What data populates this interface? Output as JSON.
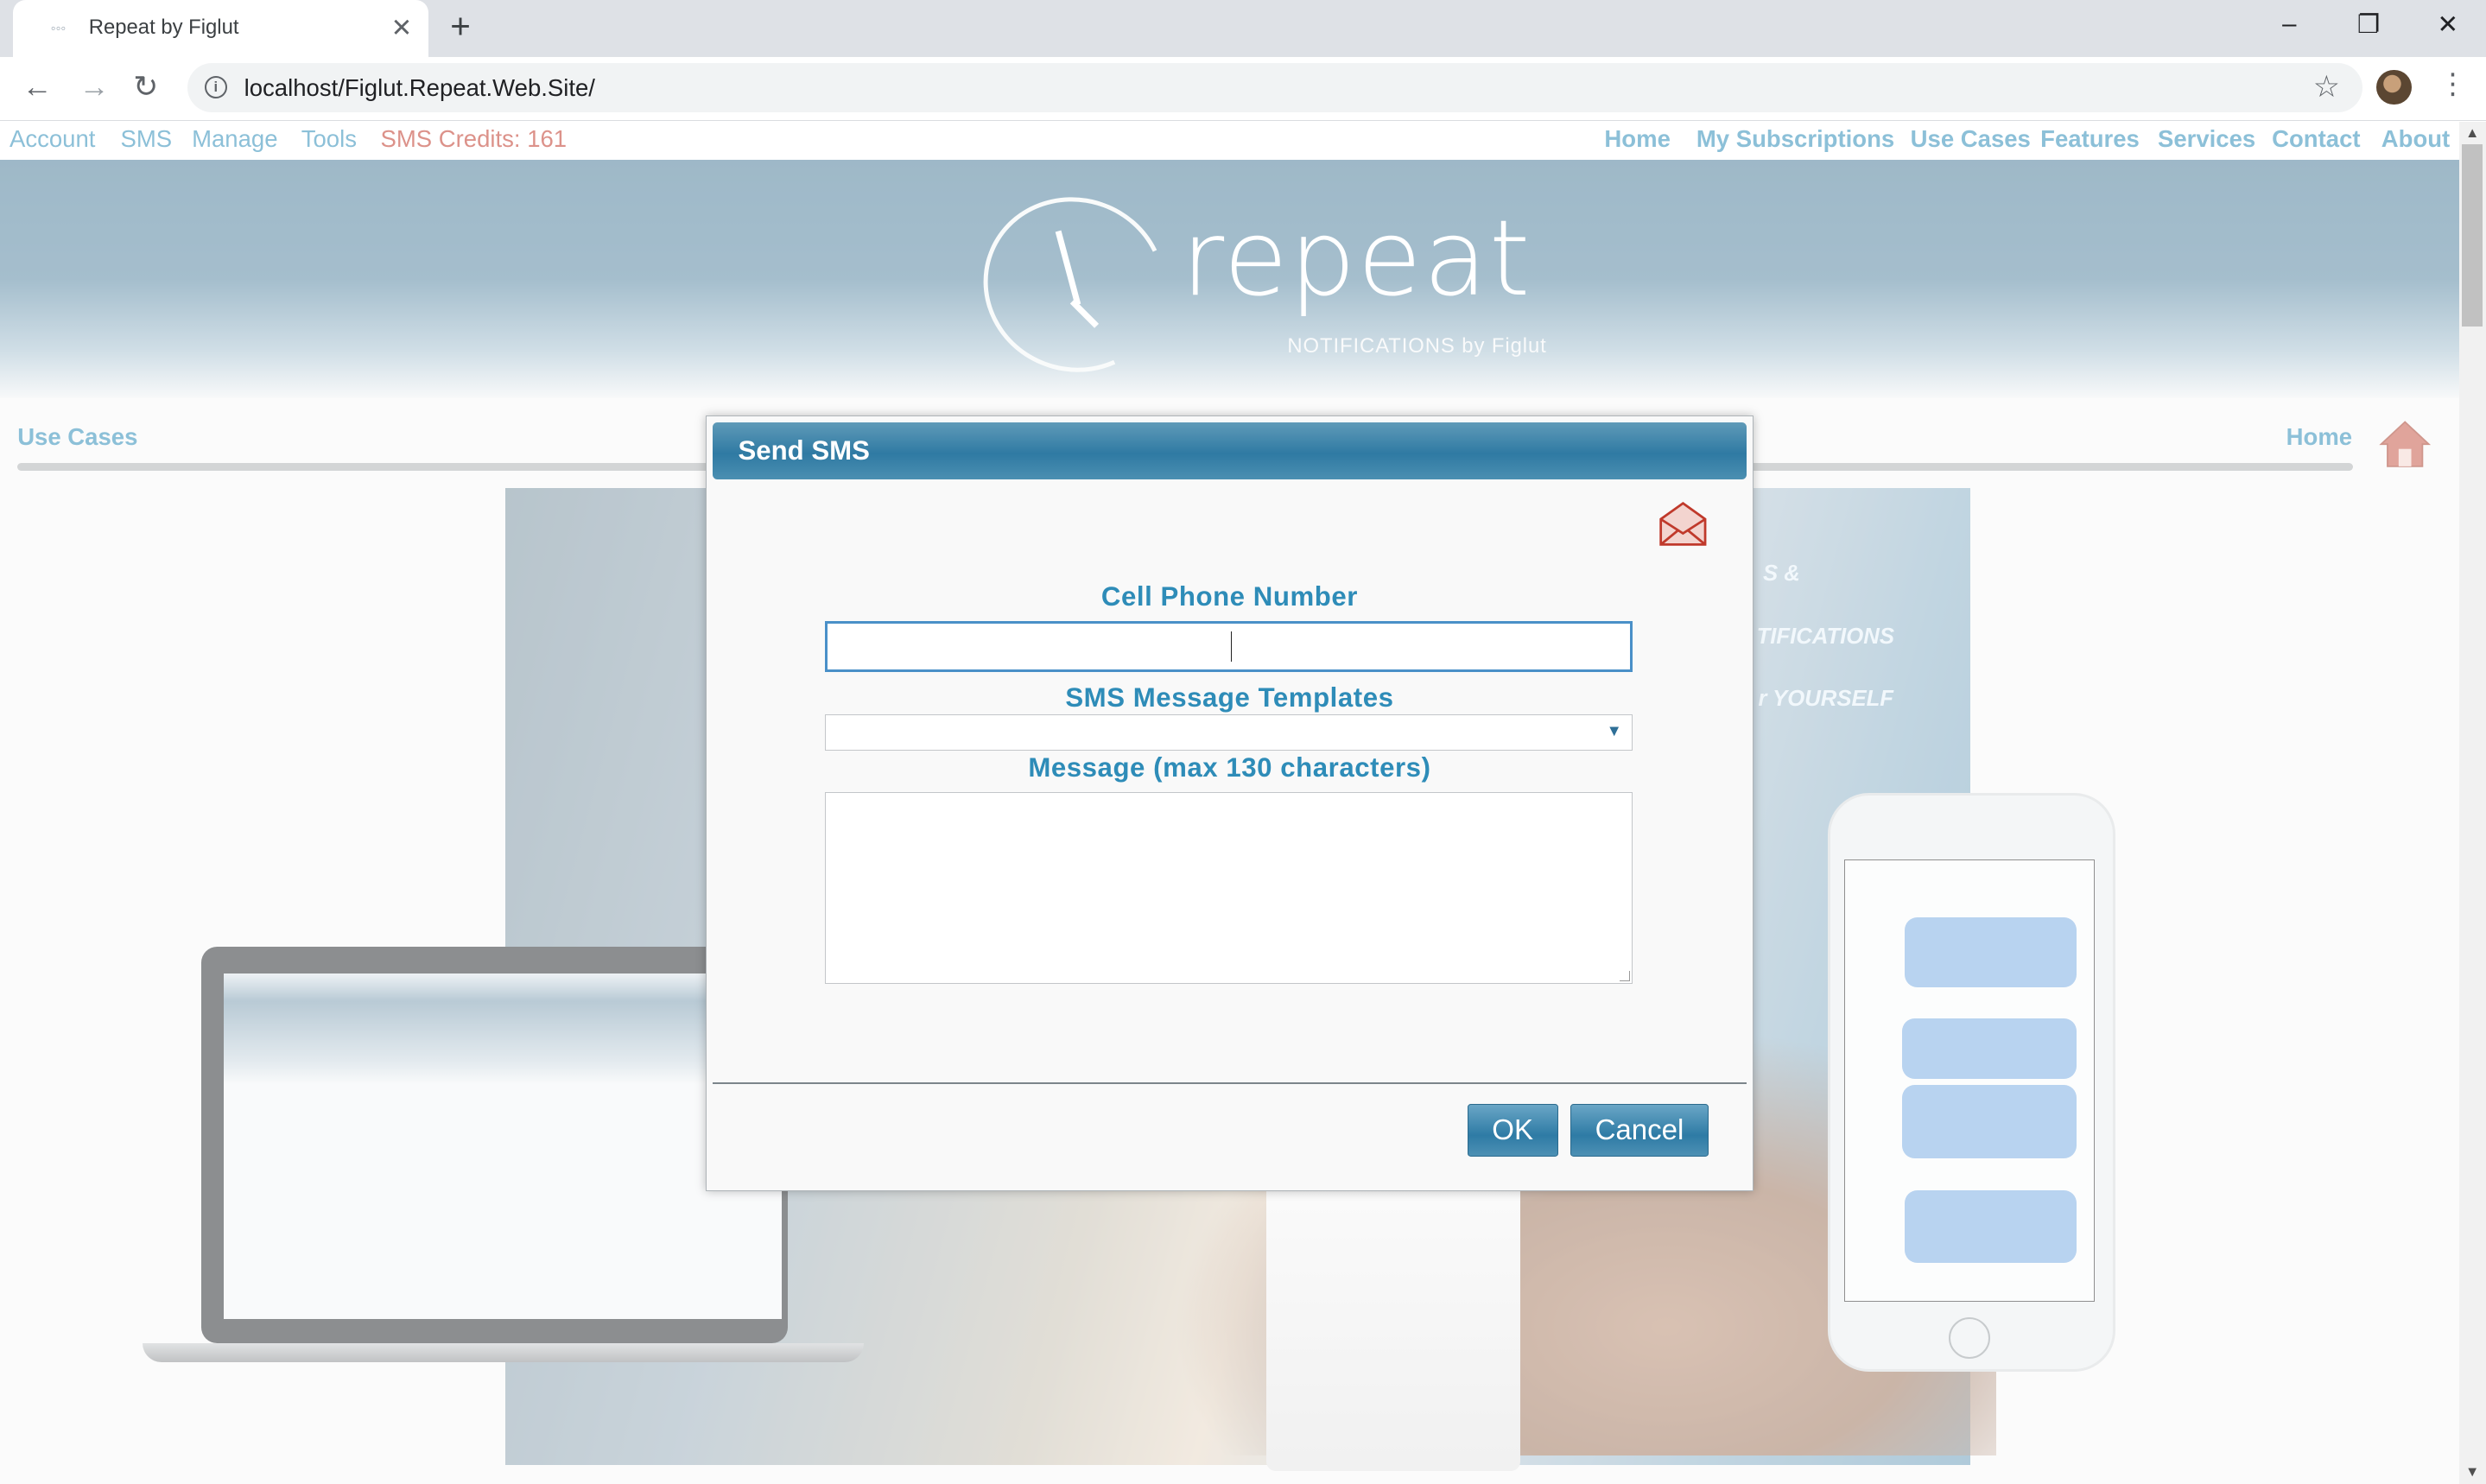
{
  "browser": {
    "tab_title": "Repeat by Figlut",
    "new_tab": "+",
    "close_tab": "✕",
    "url": "localhost/Figlut.Repeat.Web.Site/"
  },
  "site_nav": {
    "left": [
      "Account",
      "SMS",
      "Manage",
      "Tools"
    ],
    "credits": "SMS Credits: 161",
    "right": [
      "Home",
      "My Subscriptions",
      "Use Cases",
      "Features",
      "Services",
      "Contact",
      "About"
    ]
  },
  "banner": {
    "logo_word": "repeat",
    "tagline": "NOTIFICATIONS by Figlut"
  },
  "breadcrumb": {
    "left": "Use Cases",
    "right": "Home"
  },
  "hero": {
    "text_lines": [
      "S &",
      "TIFICATIONS",
      "r YOURSELF"
    ]
  },
  "dialog": {
    "title": "Send SMS",
    "phone_label": "Cell Phone Number",
    "phone_value": "",
    "templates_label": "SMS Message Templates",
    "templates_selected": "",
    "message_label": "Message (max 130 characters)",
    "message_value": "",
    "ok_label": "OK",
    "cancel_label": "Cancel"
  },
  "colors": {
    "link": "#2e8cb8",
    "credits": "#c0392b",
    "dialog_header": "#2f7aa3"
  }
}
